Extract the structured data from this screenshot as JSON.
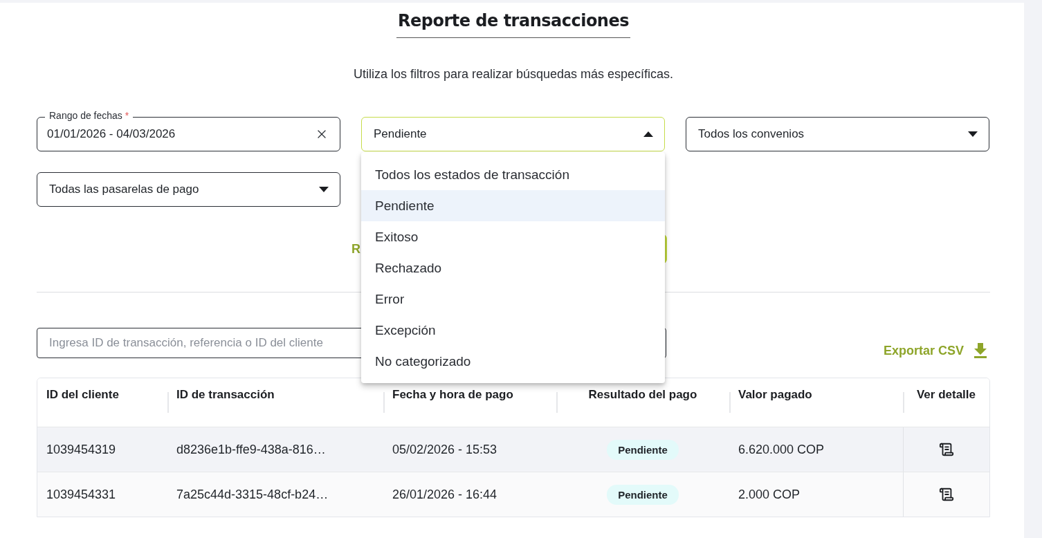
{
  "page": {
    "title": "Reporte de transacciones",
    "subtitle": "Utiliza los filtros para realizar búsquedas más específicas."
  },
  "filters": [
    {
      "kind": "date_range",
      "label": "Rango de fechas",
      "required_mark": "*",
      "value": "01/01/2026 - 04/03/2026"
    },
    {
      "kind": "select",
      "value": "Pendiente",
      "open": true,
      "options": [
        {
          "label": "Todos los estados de transacción",
          "selected": false
        },
        {
          "label": "Pendiente",
          "selected": true
        },
        {
          "label": "Exitoso",
          "selected": false
        },
        {
          "label": "Rechazado",
          "selected": false
        },
        {
          "label": "Error",
          "selected": false
        },
        {
          "label": "Excepción",
          "selected": false
        },
        {
          "label": "No categorizado",
          "selected": false
        }
      ]
    },
    {
      "kind": "select",
      "value": "Todos los convenios",
      "open": false
    },
    {
      "kind": "select",
      "value": "Todas las pasarelas de pago",
      "open": false
    }
  ],
  "actions": {
    "reset_label": "R"
  },
  "search": {
    "placeholder": "Ingresa ID de transacción, referencia o ID del cliente"
  },
  "export": {
    "label": "Exportar CSV"
  },
  "table": {
    "columns": [
      "ID del cliente",
      "ID de transacción",
      "Fecha y hora de pago",
      "Resultado del pago",
      "Valor pagado",
      "Ver detalle"
    ],
    "rows": [
      {
        "client_id": "1039454319",
        "transaction_id": "d8236e1b-ffe9-438a-816…",
        "date": "05/02/2026 - 15:53",
        "status": "Pendiente",
        "amount": "6.620.000 COP"
      },
      {
        "client_id": "1039454331",
        "transaction_id": "7a25c44d-3315-48cf-b24…",
        "date": "26/01/2026 - 16:44",
        "status": "Pendiente",
        "amount": "2.000 COP"
      }
    ]
  }
}
